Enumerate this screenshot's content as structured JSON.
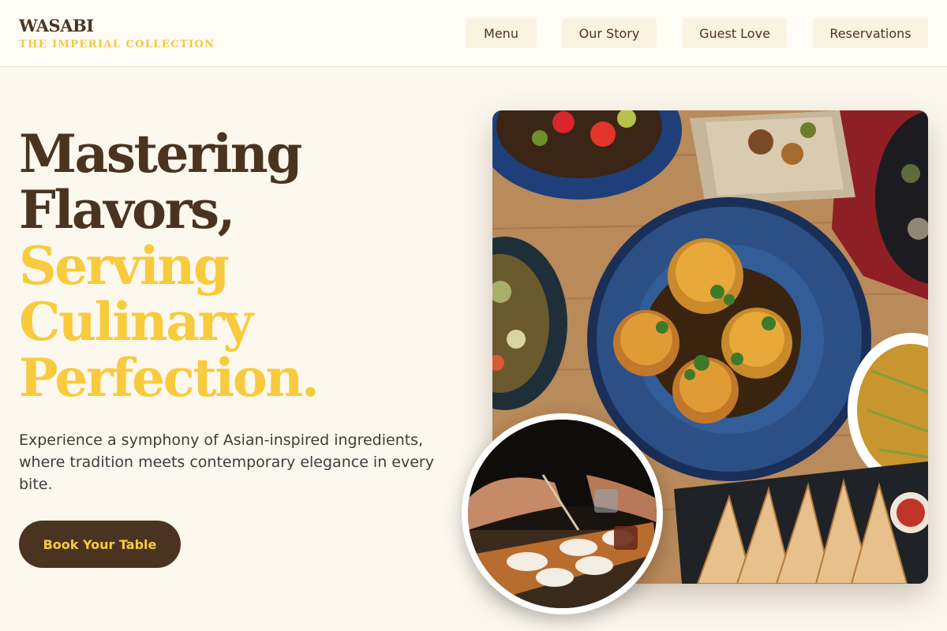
{
  "brand": {
    "name": "WASABI",
    "tagline": "THE IMPERIAL COLLECTION"
  },
  "nav": {
    "items": [
      {
        "label": "Menu"
      },
      {
        "label": "Our Story"
      },
      {
        "label": "Guest Love"
      },
      {
        "label": "Reservations"
      }
    ]
  },
  "hero": {
    "headline_dark": [
      "Mastering",
      "Flavors,"
    ],
    "headline_gold": [
      "Serving",
      "Culinary",
      "Perfection."
    ],
    "intro": "Experience a symphony of Asian-inspired ingredients, where tradition meets contemporary elegance in every bite.",
    "cta_label": "Book Your Table"
  },
  "images": {
    "main_alt": "Overhead spread of Asian dishes on a wooden table",
    "circle_alt": "Chef plating dishes at a tasting counter"
  },
  "colors": {
    "background": "#fdf8ee",
    "brown": "#4a3421",
    "gold": "#f8cb3e"
  }
}
